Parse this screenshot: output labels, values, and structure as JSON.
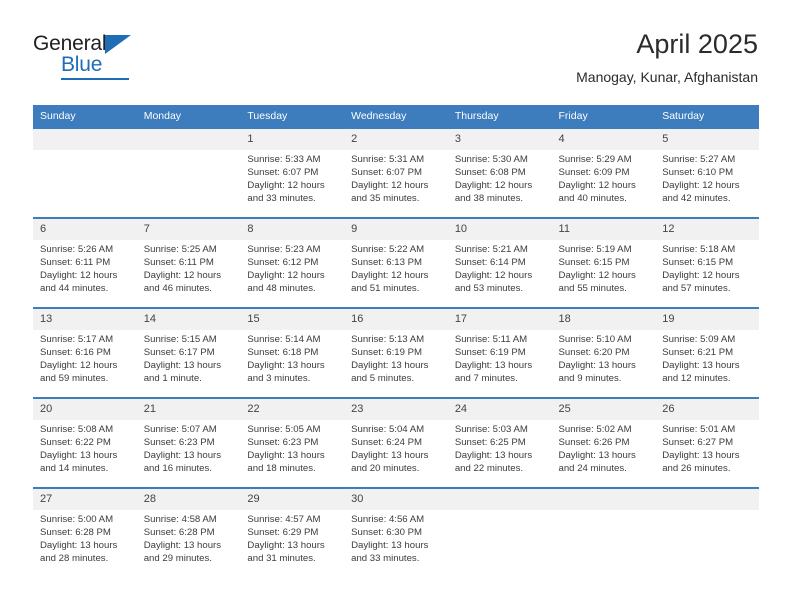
{
  "brand": {
    "name_part1": "General",
    "name_part2": "Blue",
    "accent_color": "#1f6eb5"
  },
  "header": {
    "title": "April 2025",
    "subtitle": "Manogay, Kunar, Afghanistan",
    "header_bg_color": "#3d7cbd"
  },
  "calendar": {
    "weekday_headers": [
      "Sunday",
      "Monday",
      "Tuesday",
      "Wednesday",
      "Thursday",
      "Friday",
      "Saturday"
    ],
    "weeks": [
      [
        {
          "day": "",
          "empty": true,
          "sunrise": "",
          "sunset": "",
          "daylight_line1": "",
          "daylight_line2": ""
        },
        {
          "day": "",
          "empty": true,
          "sunrise": "",
          "sunset": "",
          "daylight_line1": "",
          "daylight_line2": ""
        },
        {
          "day": "1",
          "sunrise": "Sunrise: 5:33 AM",
          "sunset": "Sunset: 6:07 PM",
          "daylight_line1": "Daylight: 12 hours",
          "daylight_line2": "and 33 minutes."
        },
        {
          "day": "2",
          "sunrise": "Sunrise: 5:31 AM",
          "sunset": "Sunset: 6:07 PM",
          "daylight_line1": "Daylight: 12 hours",
          "daylight_line2": "and 35 minutes."
        },
        {
          "day": "3",
          "sunrise": "Sunrise: 5:30 AM",
          "sunset": "Sunset: 6:08 PM",
          "daylight_line1": "Daylight: 12 hours",
          "daylight_line2": "and 38 minutes."
        },
        {
          "day": "4",
          "sunrise": "Sunrise: 5:29 AM",
          "sunset": "Sunset: 6:09 PM",
          "daylight_line1": "Daylight: 12 hours",
          "daylight_line2": "and 40 minutes."
        },
        {
          "day": "5",
          "sunrise": "Sunrise: 5:27 AM",
          "sunset": "Sunset: 6:10 PM",
          "daylight_line1": "Daylight: 12 hours",
          "daylight_line2": "and 42 minutes."
        }
      ],
      [
        {
          "day": "6",
          "sunrise": "Sunrise: 5:26 AM",
          "sunset": "Sunset: 6:11 PM",
          "daylight_line1": "Daylight: 12 hours",
          "daylight_line2": "and 44 minutes."
        },
        {
          "day": "7",
          "sunrise": "Sunrise: 5:25 AM",
          "sunset": "Sunset: 6:11 PM",
          "daylight_line1": "Daylight: 12 hours",
          "daylight_line2": "and 46 minutes."
        },
        {
          "day": "8",
          "sunrise": "Sunrise: 5:23 AM",
          "sunset": "Sunset: 6:12 PM",
          "daylight_line1": "Daylight: 12 hours",
          "daylight_line2": "and 48 minutes."
        },
        {
          "day": "9",
          "sunrise": "Sunrise: 5:22 AM",
          "sunset": "Sunset: 6:13 PM",
          "daylight_line1": "Daylight: 12 hours",
          "daylight_line2": "and 51 minutes."
        },
        {
          "day": "10",
          "sunrise": "Sunrise: 5:21 AM",
          "sunset": "Sunset: 6:14 PM",
          "daylight_line1": "Daylight: 12 hours",
          "daylight_line2": "and 53 minutes."
        },
        {
          "day": "11",
          "sunrise": "Sunrise: 5:19 AM",
          "sunset": "Sunset: 6:15 PM",
          "daylight_line1": "Daylight: 12 hours",
          "daylight_line2": "and 55 minutes."
        },
        {
          "day": "12",
          "sunrise": "Sunrise: 5:18 AM",
          "sunset": "Sunset: 6:15 PM",
          "daylight_line1": "Daylight: 12 hours",
          "daylight_line2": "and 57 minutes."
        }
      ],
      [
        {
          "day": "13",
          "sunrise": "Sunrise: 5:17 AM",
          "sunset": "Sunset: 6:16 PM",
          "daylight_line1": "Daylight: 12 hours",
          "daylight_line2": "and 59 minutes."
        },
        {
          "day": "14",
          "sunrise": "Sunrise: 5:15 AM",
          "sunset": "Sunset: 6:17 PM",
          "daylight_line1": "Daylight: 13 hours",
          "daylight_line2": "and 1 minute."
        },
        {
          "day": "15",
          "sunrise": "Sunrise: 5:14 AM",
          "sunset": "Sunset: 6:18 PM",
          "daylight_line1": "Daylight: 13 hours",
          "daylight_line2": "and 3 minutes."
        },
        {
          "day": "16",
          "sunrise": "Sunrise: 5:13 AM",
          "sunset": "Sunset: 6:19 PM",
          "daylight_line1": "Daylight: 13 hours",
          "daylight_line2": "and 5 minutes."
        },
        {
          "day": "17",
          "sunrise": "Sunrise: 5:11 AM",
          "sunset": "Sunset: 6:19 PM",
          "daylight_line1": "Daylight: 13 hours",
          "daylight_line2": "and 7 minutes."
        },
        {
          "day": "18",
          "sunrise": "Sunrise: 5:10 AM",
          "sunset": "Sunset: 6:20 PM",
          "daylight_line1": "Daylight: 13 hours",
          "daylight_line2": "and 9 minutes."
        },
        {
          "day": "19",
          "sunrise": "Sunrise: 5:09 AM",
          "sunset": "Sunset: 6:21 PM",
          "daylight_line1": "Daylight: 13 hours",
          "daylight_line2": "and 12 minutes."
        }
      ],
      [
        {
          "day": "20",
          "sunrise": "Sunrise: 5:08 AM",
          "sunset": "Sunset: 6:22 PM",
          "daylight_line1": "Daylight: 13 hours",
          "daylight_line2": "and 14 minutes."
        },
        {
          "day": "21",
          "sunrise": "Sunrise: 5:07 AM",
          "sunset": "Sunset: 6:23 PM",
          "daylight_line1": "Daylight: 13 hours",
          "daylight_line2": "and 16 minutes."
        },
        {
          "day": "22",
          "sunrise": "Sunrise: 5:05 AM",
          "sunset": "Sunset: 6:23 PM",
          "daylight_line1": "Daylight: 13 hours",
          "daylight_line2": "and 18 minutes."
        },
        {
          "day": "23",
          "sunrise": "Sunrise: 5:04 AM",
          "sunset": "Sunset: 6:24 PM",
          "daylight_line1": "Daylight: 13 hours",
          "daylight_line2": "and 20 minutes."
        },
        {
          "day": "24",
          "sunrise": "Sunrise: 5:03 AM",
          "sunset": "Sunset: 6:25 PM",
          "daylight_line1": "Daylight: 13 hours",
          "daylight_line2": "and 22 minutes."
        },
        {
          "day": "25",
          "sunrise": "Sunrise: 5:02 AM",
          "sunset": "Sunset: 6:26 PM",
          "daylight_line1": "Daylight: 13 hours",
          "daylight_line2": "and 24 minutes."
        },
        {
          "day": "26",
          "sunrise": "Sunrise: 5:01 AM",
          "sunset": "Sunset: 6:27 PM",
          "daylight_line1": "Daylight: 13 hours",
          "daylight_line2": "and 26 minutes."
        }
      ],
      [
        {
          "day": "27",
          "sunrise": "Sunrise: 5:00 AM",
          "sunset": "Sunset: 6:28 PM",
          "daylight_line1": "Daylight: 13 hours",
          "daylight_line2": "and 28 minutes."
        },
        {
          "day": "28",
          "sunrise": "Sunrise: 4:58 AM",
          "sunset": "Sunset: 6:28 PM",
          "daylight_line1": "Daylight: 13 hours",
          "daylight_line2": "and 29 minutes."
        },
        {
          "day": "29",
          "sunrise": "Sunrise: 4:57 AM",
          "sunset": "Sunset: 6:29 PM",
          "daylight_line1": "Daylight: 13 hours",
          "daylight_line2": "and 31 minutes."
        },
        {
          "day": "30",
          "sunrise": "Sunrise: 4:56 AM",
          "sunset": "Sunset: 6:30 PM",
          "daylight_line1": "Daylight: 13 hours",
          "daylight_line2": "and 33 minutes."
        },
        {
          "day": "",
          "empty": true,
          "sunrise": "",
          "sunset": "",
          "daylight_line1": "",
          "daylight_line2": ""
        },
        {
          "day": "",
          "empty": true,
          "sunrise": "",
          "sunset": "",
          "daylight_line1": "",
          "daylight_line2": ""
        },
        {
          "day": "",
          "empty": true,
          "sunrise": "",
          "sunset": "",
          "daylight_line1": "",
          "daylight_line2": ""
        }
      ]
    ]
  }
}
